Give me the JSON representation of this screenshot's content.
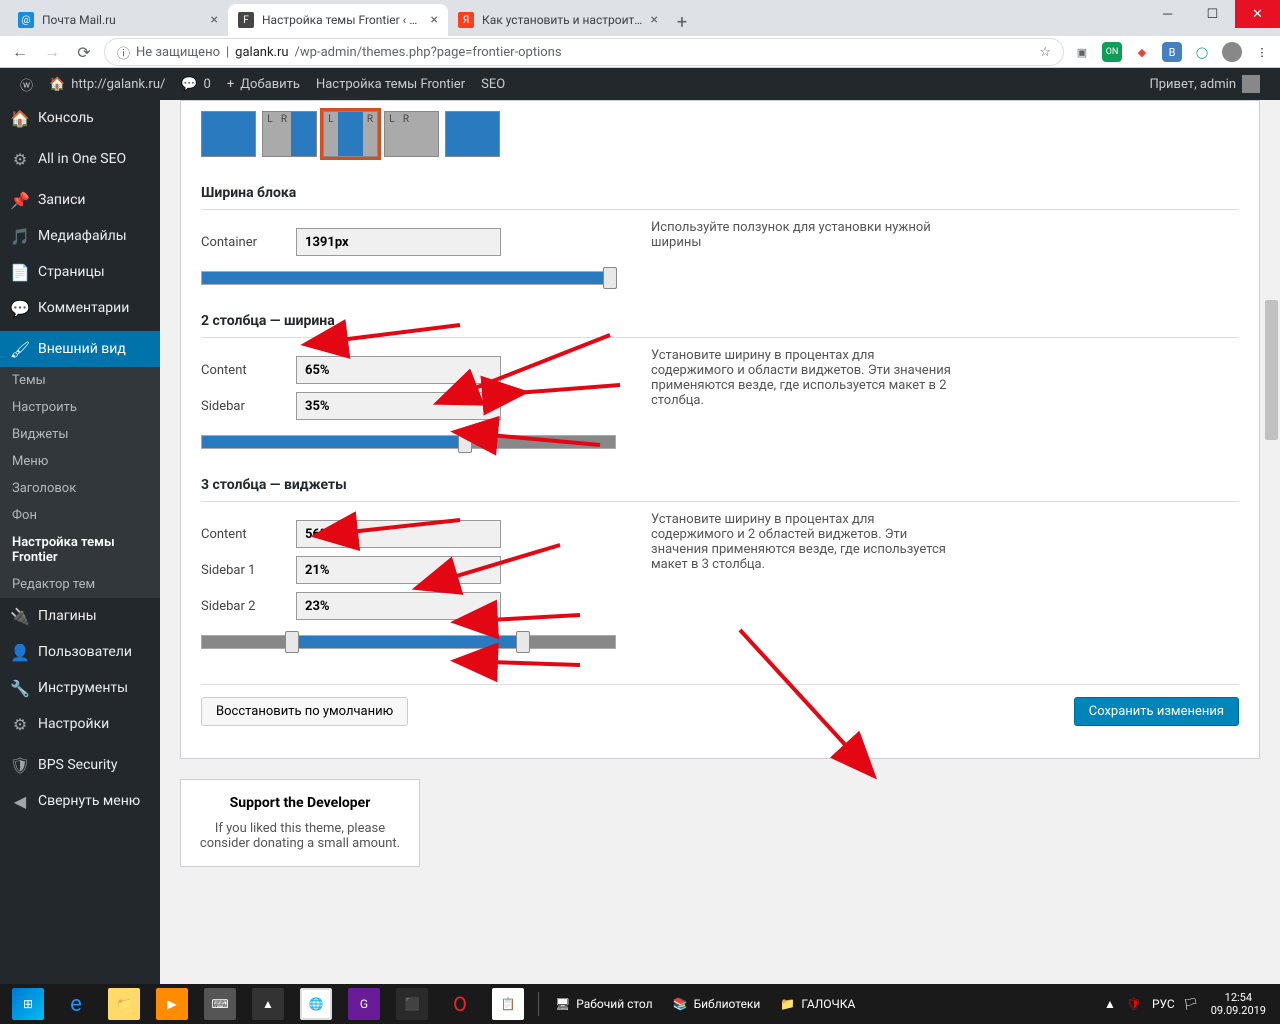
{
  "browser": {
    "tabs": [
      {
        "title": "Почта Mail.ru",
        "favicon": "m"
      },
      {
        "title": "Настройка темы Frontier ‹ http…",
        "favicon": "wp",
        "active": true
      },
      {
        "title": "Как установить и настроить те…",
        "favicon": "y"
      }
    ],
    "url_insecure": "Не защищено",
    "url_domain": "galank.ru",
    "url_path": "/wp-admin/themes.php?page=frontier-options"
  },
  "adminbar": {
    "site": "http://galank.ru/",
    "comments": "0",
    "add": "Добавить",
    "theme": "Настройка темы Frontier",
    "seo": "SEO",
    "hello": "Привет, admin"
  },
  "sidebar": {
    "items": [
      {
        "icon": "⚙",
        "label": "Консоль"
      },
      {
        "icon": "⚙",
        "label": "All in One SEO"
      },
      {
        "icon": "📌",
        "label": "Записи"
      },
      {
        "icon": "🖼",
        "label": "Медиафайлы"
      },
      {
        "icon": "📄",
        "label": "Страницы"
      },
      {
        "icon": "💬",
        "label": "Комментарии"
      },
      {
        "icon": "🖌",
        "label": "Внешний вид",
        "current": true
      },
      {
        "icon": "🔌",
        "label": "Плагины"
      },
      {
        "icon": "👤",
        "label": "Пользователи"
      },
      {
        "icon": "🔧",
        "label": "Инструменты"
      },
      {
        "icon": "⚙",
        "label": "Настройки"
      },
      {
        "icon": "🛡",
        "label": "BPS Security"
      },
      {
        "icon": "◀",
        "label": "Свернуть меню"
      }
    ],
    "submenu": [
      "Темы",
      "Настроить",
      "Виджеты",
      "Меню",
      "Заголовок",
      "Фон",
      "Настройка темы Frontier",
      "Редактор тем"
    ],
    "submenu_current": "Настройка темы Frontier"
  },
  "content": {
    "block_width_title": "Ширина блока",
    "container_label": "Container",
    "container_value": "1391px",
    "container_hint": "Используйте ползунок для установки нужной ширины",
    "two_col_title": "2 столбца — ширина",
    "two_content_label": "Content",
    "two_content_value": "65%",
    "two_sidebar_label": "Sidebar",
    "two_sidebar_value": "35%",
    "two_hint": "Установите ширину в процентах для содержимого и области виджетов. Эти значения применяются везде, где используется макет в 2 столбца.",
    "three_col_title": "3 столбца — виджеты",
    "three_content_label": "Content",
    "three_content_value": "56%",
    "three_s1_label": "Sidebar 1",
    "three_s1_value": "21%",
    "three_s2_label": "Sidebar 2",
    "three_s2_value": "23%",
    "three_hint": "Установите ширину в процентах для содержимого и 2 областей виджетов. Эти значения применяются везде, где используется макет в 3 столбца.",
    "btn_reset": "Восстановить по умолчанию",
    "btn_save": "Сохранить изменения",
    "support_title": "Support the Developer",
    "support_text": "If you liked this theme, please consider donating a small amount."
  },
  "taskbar": {
    "items": [
      "Рабочий стол",
      "Библиотеки",
      "ГАЛОЧКА"
    ],
    "lang": "РУС",
    "time": "12:54",
    "date": "09.09.2019"
  }
}
